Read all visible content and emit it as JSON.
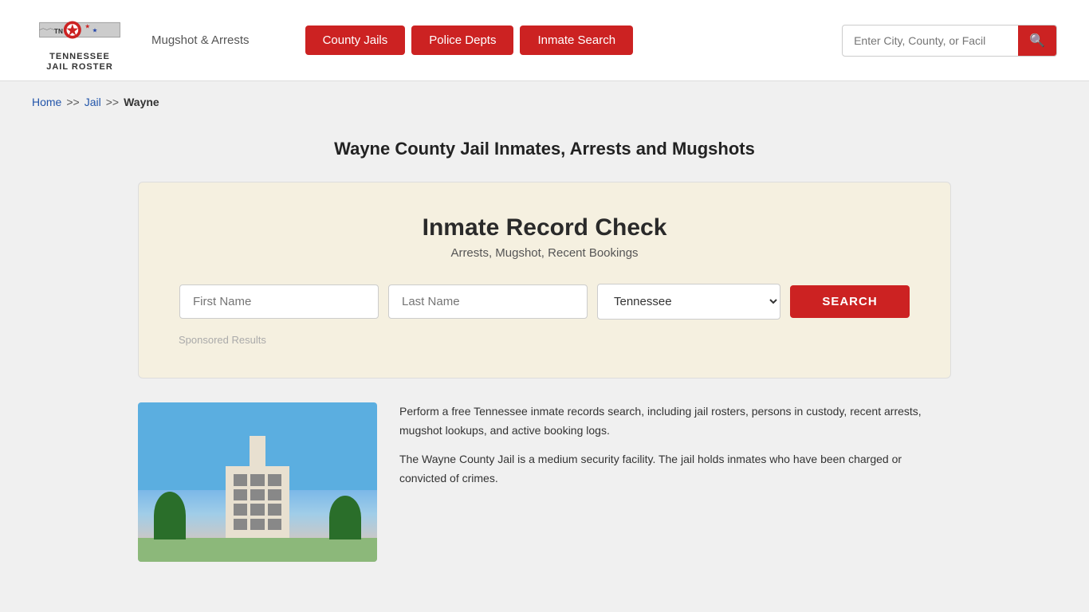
{
  "header": {
    "logo_line1": "TENNESSEE",
    "logo_line2": "JAIL ROSTER",
    "mugshot_arrests": "Mugshot & Arrests",
    "nav_buttons": [
      {
        "label": "County Jails",
        "id": "county-jails"
      },
      {
        "label": "Police Depts",
        "id": "police-depts"
      },
      {
        "label": "Inmate Search",
        "id": "inmate-search"
      }
    ],
    "search_placeholder": "Enter City, County, or Facil"
  },
  "breadcrumb": {
    "home": "Home",
    "separator1": ">>",
    "jail": "Jail",
    "separator2": ">>",
    "current": "Wayne"
  },
  "page_title": "Wayne County Jail Inmates, Arrests and Mugshots",
  "record_check": {
    "title": "Inmate Record Check",
    "subtitle": "Arrests, Mugshot, Recent Bookings",
    "first_name_placeholder": "First Name",
    "last_name_placeholder": "Last Name",
    "state_default": "Tennessee",
    "search_btn": "SEARCH",
    "sponsored": "Sponsored Results"
  },
  "description": {
    "para1": "Perform a free Tennessee inmate records search, including jail rosters, persons in custody, recent arrests, mugshot lookups, and active booking logs.",
    "para2": "The Wayne County Jail is a medium security facility. The jail holds inmates who have been charged or convicted of crimes."
  }
}
